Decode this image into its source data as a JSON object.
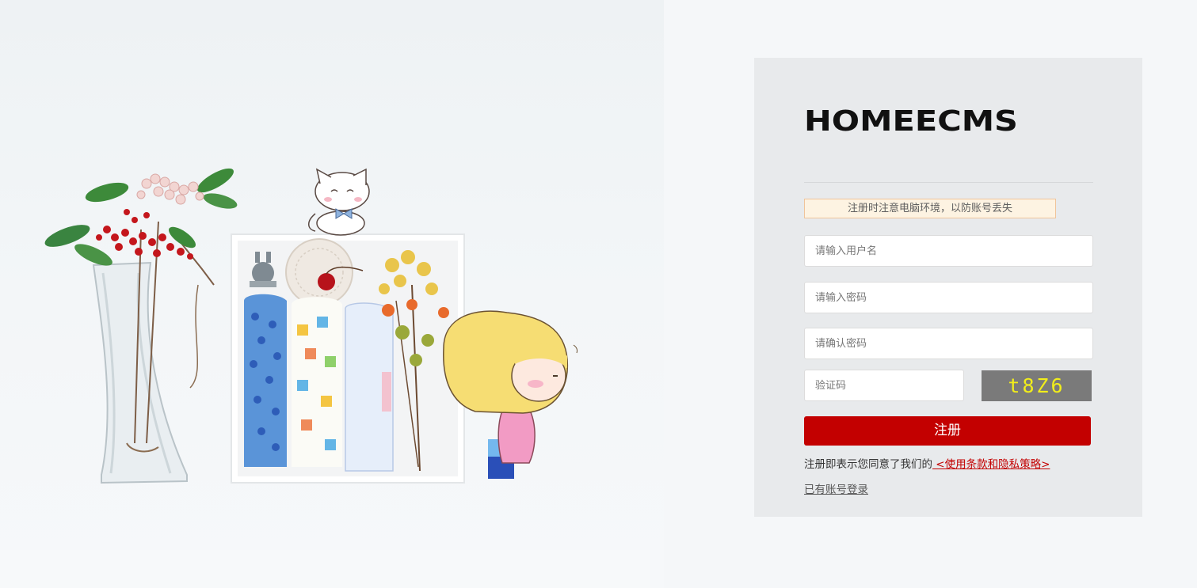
{
  "brand": {
    "logo_text": "HOMEECMS"
  },
  "form": {
    "notice": "注册时注意电脑环境，以防账号丢失",
    "username_placeholder": "请输入用户名",
    "password_placeholder": "请输入密码",
    "confirm_placeholder": "请确认密码",
    "captcha_placeholder": "验证码",
    "captcha_text": "t8Z6",
    "submit_label": "注册",
    "agree_text": "注册即表示您同意了我们的",
    "terms_link": " <使用条款和隐私策略>",
    "login_link": "已有账号登录"
  },
  "colors": {
    "accent": "#c30000",
    "panel": "#e8eaec",
    "captcha_bg": "#7a7a7a",
    "captcha_text": "#f2ee1a",
    "notice_bg": "#fdf3e2",
    "notice_border": "#f0c49a"
  }
}
